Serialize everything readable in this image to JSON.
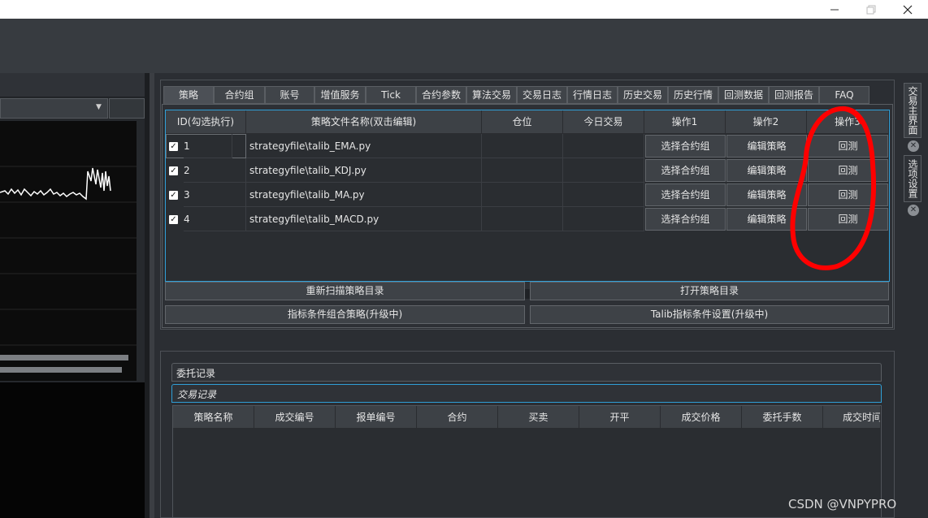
{
  "window": {
    "minimize_icon": "minimize-icon",
    "restore_icon": "restore-icon",
    "close_icon": "close-icon"
  },
  "main_tabs": [
    {
      "label": "策略"
    },
    {
      "label": "合约组"
    },
    {
      "label": "账号"
    },
    {
      "label": "增值服务"
    },
    {
      "label": "Tick"
    },
    {
      "label": "合约参数"
    },
    {
      "label": "算法交易"
    },
    {
      "label": "交易日志"
    },
    {
      "label": "行情日志"
    },
    {
      "label": "历史交易"
    },
    {
      "label": "历史行情"
    },
    {
      "label": "回测数据"
    },
    {
      "label": "回测报告"
    },
    {
      "label": "FAQ"
    }
  ],
  "strategy_table": {
    "headers": [
      "ID(勾选执行)",
      "策略文件名称(双击编辑)",
      "仓位",
      "今日交易",
      "操作1",
      "操作2",
      "操作3"
    ],
    "rows": [
      {
        "id": "1",
        "file": "strategyfile\\talib_EMA.py",
        "op1": "选择合约组",
        "op2": "编辑策略",
        "op3": "回测"
      },
      {
        "id": "2",
        "file": "strategyfile\\talib_KDJ.py",
        "op1": "选择合约组",
        "op2": "编辑策略",
        "op3": "回测"
      },
      {
        "id": "3",
        "file": "strategyfile\\talib_MA.py",
        "op1": "选择合约组",
        "op2": "编辑策略",
        "op3": "回测"
      },
      {
        "id": "4",
        "file": "strategyfile\\talib_MACD.py",
        "op1": "选择合约组",
        "op2": "编辑策略",
        "op3": "回测"
      }
    ]
  },
  "actions": {
    "rescan": "重新扫描策略目录",
    "open_dir": "打开策略目录",
    "combo_strategy": "指标条件组合策略(升级中)",
    "talib_settings": "Talib指标条件设置(升级中)"
  },
  "orders": {
    "tab1": "委托记录",
    "tab2": "交易记录",
    "headers": [
      "策略名称",
      "成交编号",
      "报单编号",
      "合约",
      "买卖",
      "开平",
      "成交价格",
      "委托手数",
      "成交时间"
    ]
  },
  "side_tabs": [
    {
      "label": "交易主界面"
    },
    {
      "label": "选项设置"
    }
  ],
  "watermark": "CSDN @VNPYPRO",
  "colors": {
    "accent": "#2f9fd7",
    "annotation": "#ff0000"
  }
}
